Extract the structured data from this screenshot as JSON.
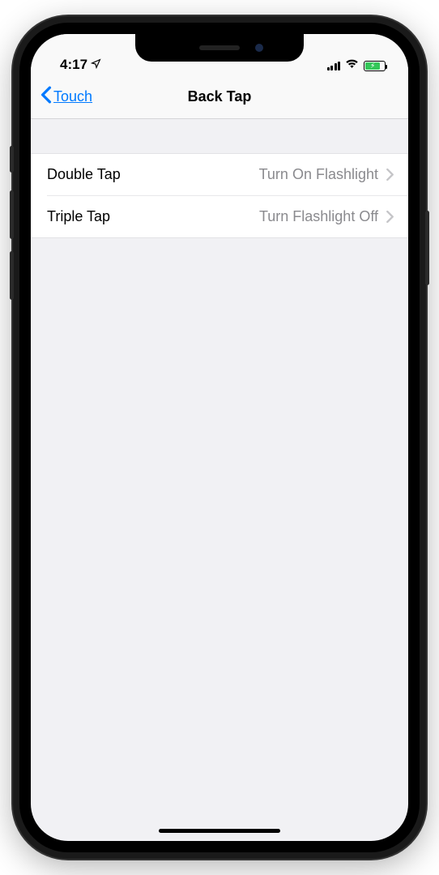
{
  "statusBar": {
    "time": "4:17"
  },
  "navBar": {
    "backLabel": "Touch",
    "title": "Back Tap"
  },
  "settings": {
    "rows": [
      {
        "label": "Double Tap",
        "value": "Turn On Flashlight"
      },
      {
        "label": "Triple Tap",
        "value": "Turn Flashlight Off"
      }
    ]
  }
}
